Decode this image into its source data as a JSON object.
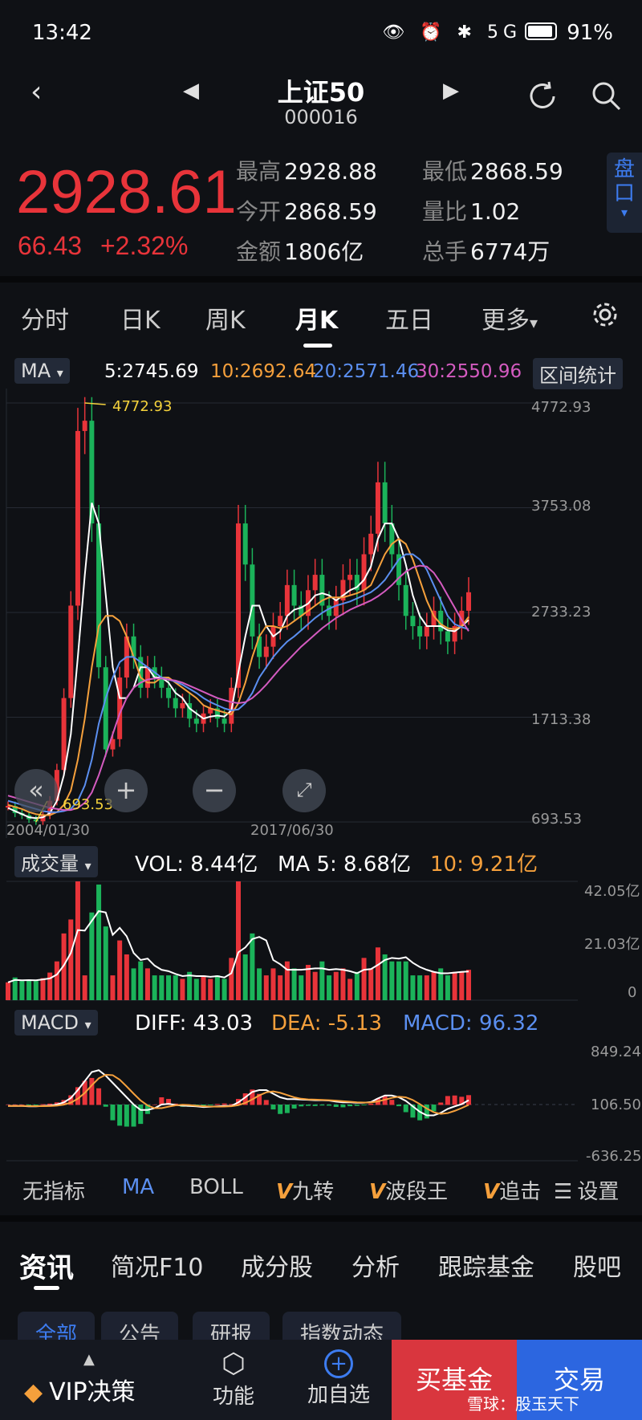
{
  "status": {
    "time": "13:42",
    "battery": "91%",
    "icons": "👁 ⏰ ✱ 5G"
  },
  "header": {
    "title": "上证50",
    "code": "000016"
  },
  "quote": {
    "price": "2928.61",
    "change": "66.43",
    "change_pct": "+2.32%",
    "stats": [
      {
        "label": "最高",
        "value": "2928.88"
      },
      {
        "label": "最低",
        "value": "2868.59"
      },
      {
        "label": "今开",
        "value": "2868.59"
      },
      {
        "label": "量比",
        "value": "1.02"
      },
      {
        "label": "金额",
        "value": "1806亿"
      },
      {
        "label": "总手",
        "value": "6774万"
      }
    ],
    "pankou": "盘口"
  },
  "tabs": [
    "分时",
    "日K",
    "周K",
    "月K",
    "五日",
    "更多"
  ],
  "ma_bar": {
    "selector": "MA",
    "ma5": "5:2745.69",
    "ma10": "10:2692.64",
    "ma20": "20:2571.46",
    "ma30": "30:2550.96",
    "range_btn": "区间统计",
    "colors": {
      "ma5": "#ffffff",
      "ma10": "#f5a03c",
      "ma20": "#5b8ff0",
      "ma30": "#d45bc0"
    }
  },
  "price_chart": {
    "y_ticks": [
      "4772.93",
      "3753.08",
      "2733.23",
      "1713.38",
      "693.53"
    ],
    "max_label": "4772.93",
    "min_label": "693.53",
    "x_labels": [
      "2004/01/30",
      "2017/06/30"
    ]
  },
  "volume": {
    "selector": "成交量",
    "vol": "VOL: 8.44亿",
    "ma5": "MA 5: 8.68亿",
    "ma10": "10: 9.21亿",
    "y_ticks": [
      "42.05亿",
      "21.03亿",
      "0"
    ]
  },
  "macd": {
    "selector": "MACD",
    "diff": "DIFF: 43.03",
    "dea": "DEA: -5.13",
    "macd": "MACD: 96.32",
    "y_ticks": [
      "849.24",
      "106.50",
      "-636.25"
    ]
  },
  "indicators": [
    "无指标",
    "MA",
    "BOLL",
    "九转",
    "波段王",
    "追击",
    "设置"
  ],
  "sections": [
    "资讯",
    "简况F10",
    "成分股",
    "分析",
    "跟踪基金",
    "股吧"
  ],
  "sub_tabs": [
    "全部",
    "公告",
    "研报",
    "指数动态"
  ],
  "bottom": {
    "vip": "VIP决策",
    "func": "功能",
    "add": "加自选",
    "buy_fund": "买基金",
    "trade": "交易",
    "watermark": "雪球：股玉天下"
  },
  "chart_data": {
    "type": "line",
    "title": "",
    "x_start": "2004/01/30",
    "x_mid": "2017/06/30",
    "ylim": [
      693.53,
      4772.93
    ],
    "series": [
      {
        "name": "收盘",
        "values": [
          850,
          780,
          760,
          720,
          700,
          760,
          900,
          1200,
          1900,
          2800,
          4500,
          4600,
          3600,
          2200,
          1400,
          1500,
          2100,
          2500,
          2300,
          2000,
          2200,
          2100,
          2000,
          1900,
          1800,
          1850,
          1700,
          1650,
          1750,
          1800,
          1700,
          1650,
          2000,
          3600,
          3200,
          2500,
          2300,
          2400,
          2600,
          2700,
          3000,
          2800,
          2700,
          2950,
          3100,
          2800,
          2700,
          2850,
          3050,
          3100,
          2950,
          3300,
          3500,
          4000,
          3600,
          3300,
          3000,
          2700,
          2600,
          2500,
          2600,
          2750,
          2550,
          2450,
          2600,
          2750,
          2930
        ]
      },
      {
        "name": "MA5",
        "values": [
          830,
          800,
          770,
          740,
          730,
          740,
          780,
          900,
          1150,
          1550,
          2300,
          3100,
          3800,
          3600,
          2900,
          2200,
          1900,
          1900,
          2000,
          2200,
          2200,
          2100,
          2100,
          2050,
          1950,
          1900,
          1800,
          1750,
          1700,
          1720,
          1730,
          1720,
          1780,
          2150,
          2500,
          2800,
          2800,
          2600,
          2500,
          2550,
          2700,
          2760,
          2780,
          2820,
          2900,
          2920,
          2900,
          2850,
          2900,
          2950,
          2980,
          3050,
          3180,
          3450,
          3600,
          3600,
          3450,
          3200,
          2900,
          2700,
          2600,
          2600,
          2600,
          2560,
          2550,
          2600,
          2660
        ]
      },
      {
        "name": "MA10",
        "values": [
          860,
          840,
          820,
          790,
          770,
          760,
          760,
          790,
          860,
          1000,
          1300,
          1700,
          2200,
          2600,
          2700,
          2700,
          2650,
          2500,
          2300,
          2100,
          2050,
          2050,
          2100,
          2100,
          2050,
          2000,
          1950,
          1900,
          1830,
          1800,
          1780,
          1760,
          1740,
          1850,
          2050,
          2300,
          2500,
          2600,
          2600,
          2580,
          2600,
          2650,
          2700,
          2750,
          2800,
          2850,
          2880,
          2880,
          2880,
          2900,
          2920,
          2950,
          3000,
          3150,
          3300,
          3400,
          3450,
          3400,
          3250,
          3050,
          2850,
          2700,
          2620,
          2580,
          2570,
          2600,
          2690
        ]
      },
      {
        "name": "MA20",
        "values": [
          900,
          880,
          860,
          840,
          820,
          800,
          790,
          790,
          800,
          820,
          900,
          1050,
          1300,
          1650,
          1900,
          2100,
          2250,
          2300,
          2300,
          2250,
          2200,
          2150,
          2100,
          2080,
          2060,
          2030,
          1990,
          1950,
          1900,
          1860,
          1830,
          1800,
          1780,
          1790,
          1850,
          1950,
          2100,
          2200,
          2300,
          2380,
          2450,
          2500,
          2560,
          2620,
          2680,
          2730,
          2770,
          2800,
          2820,
          2840,
          2870,
          2900,
          2930,
          2980,
          3050,
          3150,
          3250,
          3300,
          3300,
          3250,
          3150,
          3000,
          2850,
          2700,
          2620,
          2590,
          2570
        ]
      },
      {
        "name": "MA30",
        "values": [
          950,
          930,
          910,
          890,
          870,
          850,
          830,
          820,
          810,
          810,
          830,
          880,
          980,
          1150,
          1350,
          1550,
          1750,
          1900,
          2000,
          2050,
          2080,
          2090,
          2090,
          2080,
          2070,
          2050,
          2020,
          1990,
          1960,
          1930,
          1900,
          1880,
          1860,
          1850,
          1860,
          1900,
          1960,
          2030,
          2110,
          2190,
          2260,
          2330,
          2400,
          2460,
          2520,
          2580,
          2630,
          2680,
          2720,
          2760,
          2790,
          2820,
          2850,
          2890,
          2940,
          3000,
          3070,
          3130,
          3170,
          3190,
          3180,
          3120,
          3020,
          2900,
          2780,
          2660,
          2551
        ]
      }
    ]
  }
}
